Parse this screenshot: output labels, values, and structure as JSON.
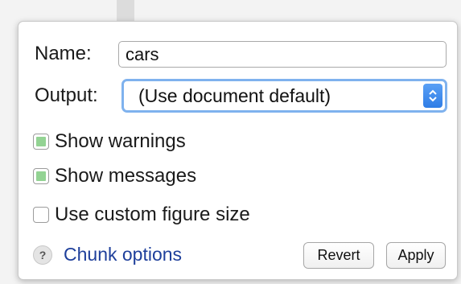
{
  "chunk_options": {
    "name_label": "Name:",
    "name_value": "cars",
    "output_label": "Output:",
    "output_selected": "(Use document default)",
    "checkboxes": [
      {
        "label": "Show warnings",
        "checked": true
      },
      {
        "label": "Show messages",
        "checked": true
      },
      {
        "label": "Use custom figure size",
        "checked": false
      }
    ],
    "help_glyph": "?",
    "link_label": "Chunk options",
    "revert_label": "Revert",
    "apply_label": "Apply"
  }
}
